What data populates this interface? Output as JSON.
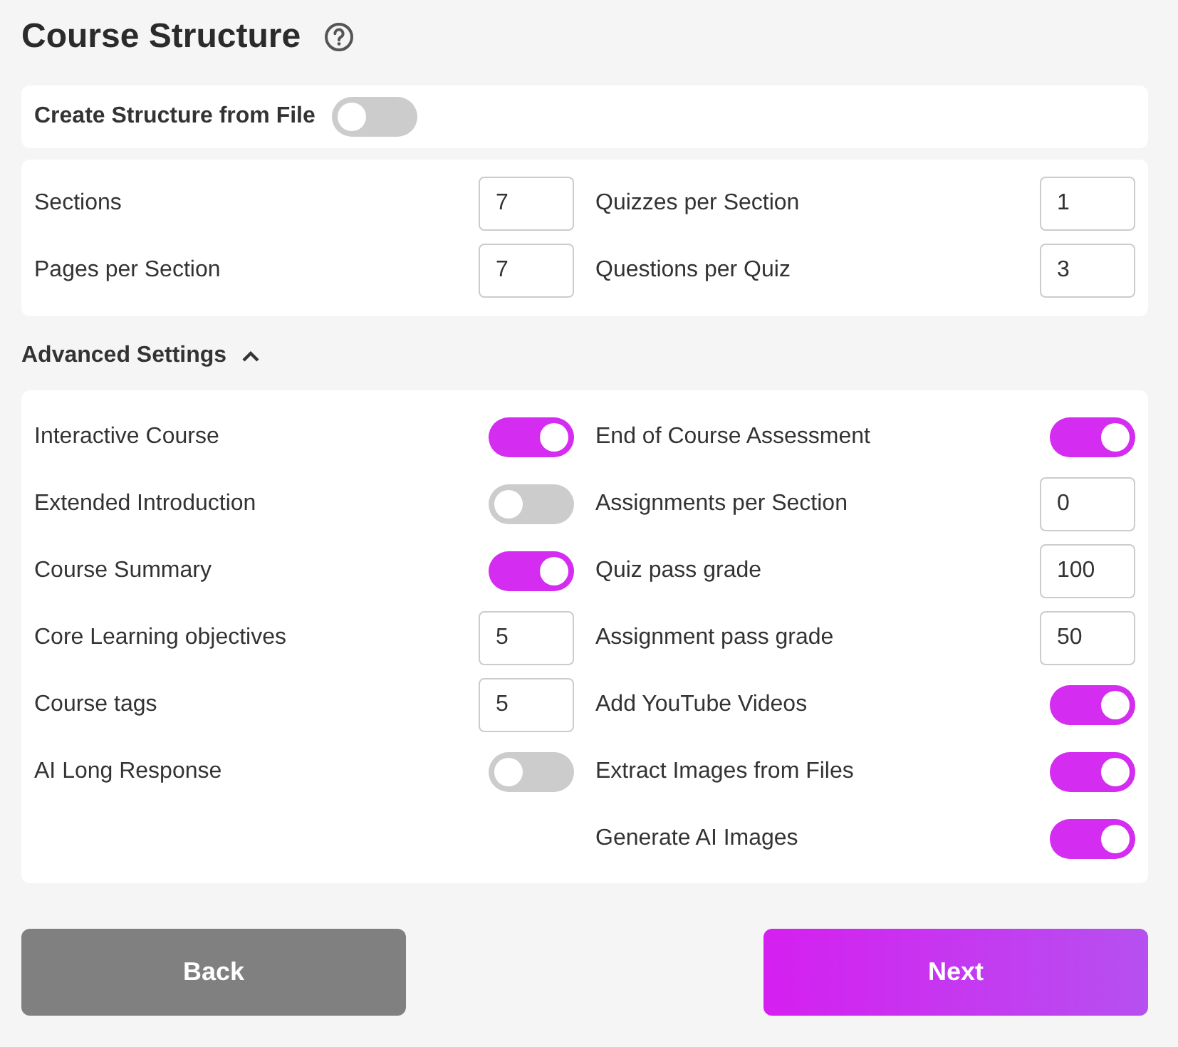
{
  "title": "Course Structure",
  "create_from_file": {
    "label": "Create Structure from File",
    "on": false
  },
  "counts": {
    "left": [
      {
        "label": "Sections",
        "value": "7"
      },
      {
        "label": "Pages per Section",
        "value": "7"
      }
    ],
    "right": [
      {
        "label": "Quizzes per Section",
        "value": "1"
      },
      {
        "label": "Questions per Quiz",
        "value": "3"
      }
    ]
  },
  "advanced": {
    "label": "Advanced Settings",
    "expanded": true,
    "left": [
      {
        "kind": "toggle",
        "label": "Interactive Course",
        "on": true
      },
      {
        "kind": "toggle",
        "label": "Extended Introduction",
        "on": false
      },
      {
        "kind": "toggle",
        "label": "Course Summary",
        "on": true
      },
      {
        "kind": "number",
        "label": "Core Learning objectives",
        "value": "5"
      },
      {
        "kind": "number",
        "label": "Course tags",
        "value": "5"
      },
      {
        "kind": "toggle",
        "label": "AI Long Response",
        "on": false
      }
    ],
    "right": [
      {
        "kind": "toggle",
        "label": "End of Course Assessment",
        "on": true
      },
      {
        "kind": "number",
        "label": "Assignments per Section",
        "value": "0"
      },
      {
        "kind": "number",
        "label": "Quiz pass grade",
        "value": "100"
      },
      {
        "kind": "number",
        "label": "Assignment pass grade",
        "value": "50"
      },
      {
        "kind": "toggle",
        "label": "Add YouTube Videos",
        "on": true
      },
      {
        "kind": "toggle",
        "label": "Extract Images from Files",
        "on": true
      },
      {
        "kind": "toggle",
        "label": "Generate AI Images",
        "on": true
      }
    ]
  },
  "buttons": [
    {
      "kind": "secondary",
      "label": "Back"
    },
    {
      "kind": "primary",
      "label": "Next"
    }
  ]
}
